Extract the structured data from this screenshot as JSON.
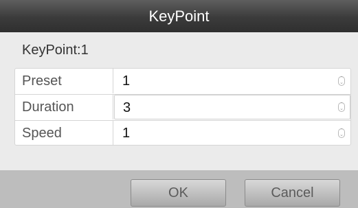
{
  "dialog": {
    "title": "KeyPoint",
    "subtitle": "KeyPoint:1",
    "fields": [
      {
        "label": "Preset",
        "value": "1"
      },
      {
        "label": "Duration",
        "value": "3"
      },
      {
        "label": "Speed",
        "value": "1"
      }
    ],
    "buttons": {
      "ok": "OK",
      "cancel": "Cancel"
    }
  }
}
